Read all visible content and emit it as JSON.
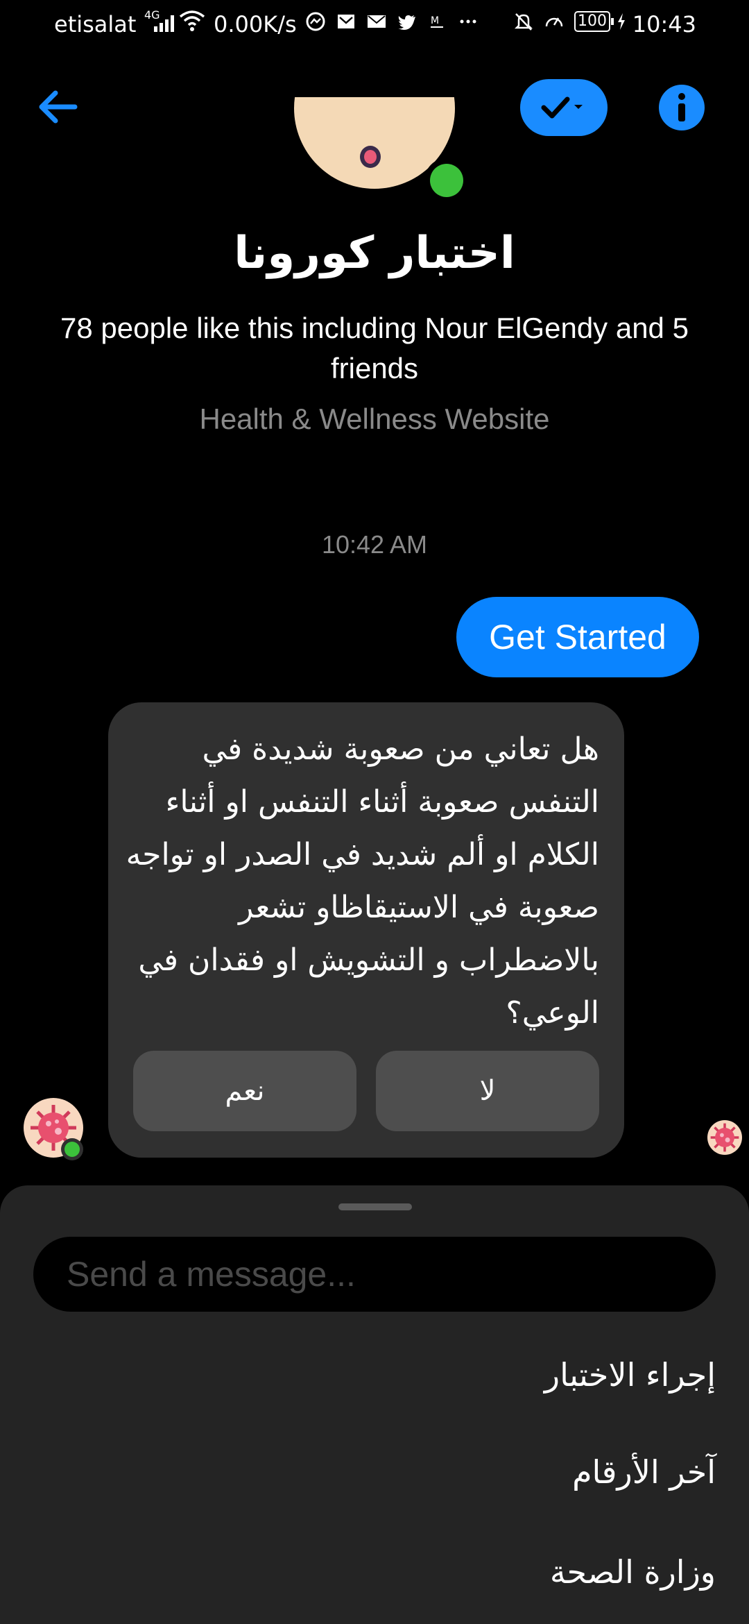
{
  "status_bar": {
    "carrier": "etisalat",
    "network_type": "4G",
    "speed": "0.00K/s",
    "battery": "100",
    "time": "10:43",
    "icons_left": [
      "messenger-icon",
      "mail-icon",
      "email-icon",
      "twitter-icon",
      "gmail-icon",
      "more-icon"
    ],
    "icons_right": [
      "mute-icon",
      "speed-icon"
    ]
  },
  "header": {
    "back_icon": "arrow-left-icon",
    "check_icon": "check-dropdown-icon",
    "info_icon": "info-icon"
  },
  "profile": {
    "name": "اختبار كورونا",
    "likes_text": "78 people like this including Nour ElGendy and 5 friends",
    "category": "Health & Wellness Website",
    "active": true
  },
  "conversation": {
    "timestamp": "10:42 AM",
    "sent_message": "Get Started",
    "bot_question": "هل تعاني من صعوبة شديدة في التنفس صعوبة أثناء التنفس او أثناء الكلام او ألم شديد في الصدر او تواجه صعوبة في الاستيقاظاو تشعر بالاضطراب و التشويش او فقدان في الوعي؟",
    "quick_replies": {
      "yes": "نعم",
      "no": "لا"
    }
  },
  "composer": {
    "placeholder": "Send a message..."
  },
  "menu": {
    "items": [
      "إجراء الاختبار",
      "آخر الأرقام",
      "وزارة الصحة"
    ]
  },
  "colors": {
    "accent": "#0a84ff",
    "background": "#000000",
    "bubble": "#303030",
    "sheet": "#242424",
    "online": "#3cc13b"
  }
}
